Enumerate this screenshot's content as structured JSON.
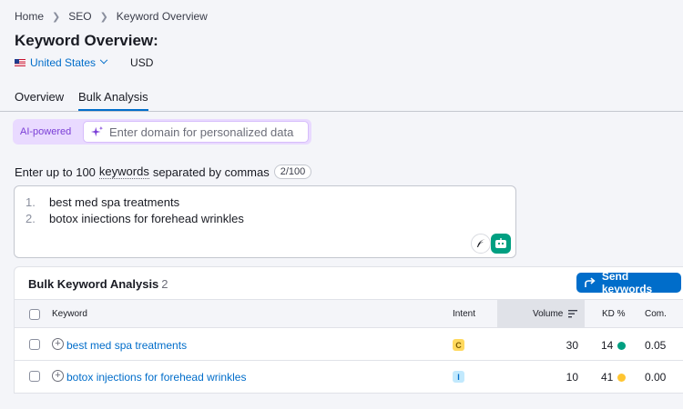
{
  "breadcrumb": [
    "Home",
    "SEO",
    "Keyword Overview"
  ],
  "page_title": "Keyword Overview:",
  "location": {
    "country": "United States",
    "currency": "USD"
  },
  "tabs": [
    {
      "label": "Overview",
      "active": false
    },
    {
      "label": "Bulk Analysis",
      "active": true
    }
  ],
  "ai": {
    "label": "AI-powered",
    "placeholder": "Enter domain for personalized data",
    "value": ""
  },
  "instructions": {
    "prefix": "Enter up to 100",
    "link": "keywords",
    "suffix": "separated by commas",
    "count": "2/100"
  },
  "keyword_input": [
    {
      "num": "1.",
      "text": "best med spa treatments"
    },
    {
      "num": "2.",
      "text": "botox iniections for forehead wrinkles"
    }
  ],
  "table": {
    "title": "Bulk Keyword Analysis",
    "count": "2",
    "send_label": "Send keywords",
    "headers": {
      "keyword": "Keyword",
      "intent": "Intent",
      "volume": "Volume",
      "kd": "KD %",
      "com": "Com."
    },
    "rows": [
      {
        "keyword": "best med spa treatments",
        "intent": "C",
        "volume": "30",
        "kd": "14",
        "kd_color": "#009f81",
        "com": "0.05"
      },
      {
        "keyword": "botox injections for forehead wrinkles",
        "intent": "I",
        "volume": "10",
        "kd": "41",
        "kd_color": "#ffc531",
        "com": "0.00"
      }
    ]
  },
  "colors": {
    "accent": "#006dca",
    "ai_purple": "#7a3ed6",
    "green": "#009f81"
  }
}
